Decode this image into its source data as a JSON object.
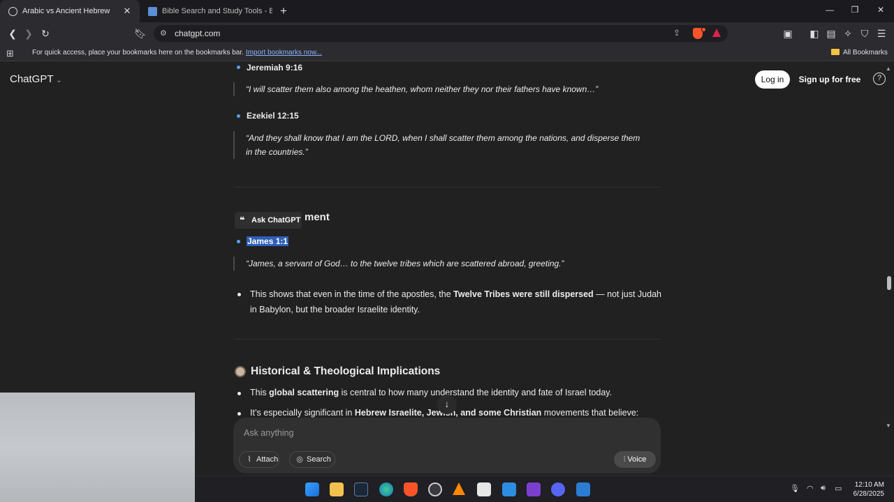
{
  "browser": {
    "tabs": [
      {
        "title": "Arabic vs Ancient Hebrew",
        "active": true
      },
      {
        "title": "Bible Search and Study Tools - Blue L",
        "active": false
      }
    ],
    "url": "chatgpt.com",
    "bookmarks_bar": {
      "hint": "For quick access, place your bookmarks here on the bookmarks bar.",
      "import_link": "Import bookmarks now...",
      "all_bookmarks": "All Bookmarks"
    }
  },
  "header": {
    "brand": "ChatGPT",
    "login": "Log in",
    "signup": "Sign up for free",
    "help": "?"
  },
  "conversation": {
    "refs": [
      {
        "ref": "Jeremiah 9:16",
        "quote": "“I will scatter them also among the heathen, whom neither they nor their fathers have known…”"
      },
      {
        "ref": "Ezekiel 12:15",
        "quote_line1": "“And they shall know that I am the LORD, when I shall scatter them among the nations, and disperse them",
        "quote_line2": "in the countries.”"
      }
    ],
    "ask_chatgpt": "Ask ChatGPT",
    "section_partial": "ment",
    "james_ref": "James 1:1",
    "james_quote": "“James, a servant of God… to the twelve tribes which are scattered abroad, greeting.”",
    "apostles_para": {
      "a": "This shows that even in the time of the apostles, the ",
      "b": "Twelve Tribes were still dispersed",
      "c": " — not just Judah",
      "line2": "in Babylon, but the broader Israelite identity."
    },
    "section_title": "Historical & Theological Implications",
    "impl_1": {
      "a": "This ",
      "b": "global scattering",
      "c": " is central to how many understand the identity and fate of Israel today."
    },
    "impl_2": {
      "a": "It’s especially significant in ",
      "b": "Hebrew Israelite, Jewish, and some Christian",
      "c": " movements that believe:"
    }
  },
  "composer": {
    "placeholder": "Ask anything",
    "attach": "Attach",
    "search": "Search",
    "voice": "Voice"
  },
  "taskbar": {
    "time": "12:10 AM",
    "date": "6/28/2025"
  }
}
